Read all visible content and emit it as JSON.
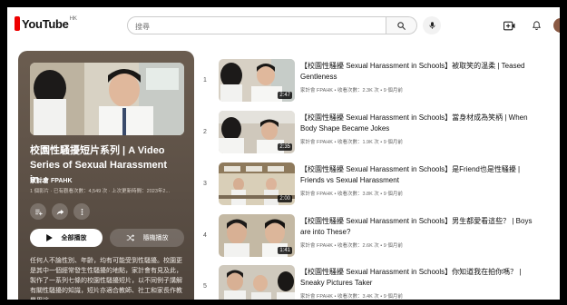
{
  "header": {
    "logo_text": "YouTube",
    "region": "HK",
    "search_placeholder": "搜尋",
    "icons": [
      "search-icon",
      "mic-icon",
      "create-icon",
      "bell-icon"
    ]
  },
  "playlist": {
    "title": "校園性騷擾短片系列 | A Video Series of Sexual Harassment in...",
    "channel": "家計會 FPAHK",
    "meta": "1 個影片 · 已有觀看次數：4,549 次 · 上次更新時間：2023年2...",
    "play_all_label": "全部播放",
    "shuffle_label": "隨機播放",
    "description": "任何人不論性別、年齡，均有可能受到性騷擾。校園更是其中一個經常發生性騷擾的地點，家計會有見及此，製作了一系列七條的校園性騷擾短片，以不同例子講解有關性騷擾的知識，短片亦適合教師、社工和家長作教學用途。"
  },
  "videos": [
    {
      "index": "1",
      "title": "【校園性騷擾 Sexual Harassment in Schools】被取笑的温柔 | Teased Gentleness",
      "sub": "家計會 FPAHK • 收看次數：2.3K 次 • 9 個月前",
      "duration": "2:47"
    },
    {
      "index": "2",
      "title": "【校園性騷擾 Sexual Harassment in Schools】當身材成為笑柄 | When Body Shape Became Jokes",
      "sub": "家計會 FPAHK • 收看次數：1.9K 次 • 9 個月前",
      "duration": "2:35"
    },
    {
      "index": "3",
      "title": "【校園性騷擾 Sexual Harassment in Schools】是Friend也是性騷擾 | Friends vs Sexual Harassment",
      "sub": "家計會 FPAHK • 收看次數：3.8K 次 • 9 個月前",
      "duration": "2:00"
    },
    {
      "index": "4",
      "title": "【校園性騷擾 Sexual Harassment in Schools】男生都愛看這些？ | Boys are into These?",
      "sub": "家計會 FPAHK • 收看次數：2.6K 次 • 9 個月前",
      "duration": "1:41"
    },
    {
      "index": "5",
      "title": "【校園性騷擾 Sexual Harassment in Schools】你知道我在拍你嗎？ | Sneaky Pictures Taker",
      "sub": "家計會 FPAHK • 收看次數：3.4K 次 • 9 個月前",
      "duration": ""
    }
  ]
}
